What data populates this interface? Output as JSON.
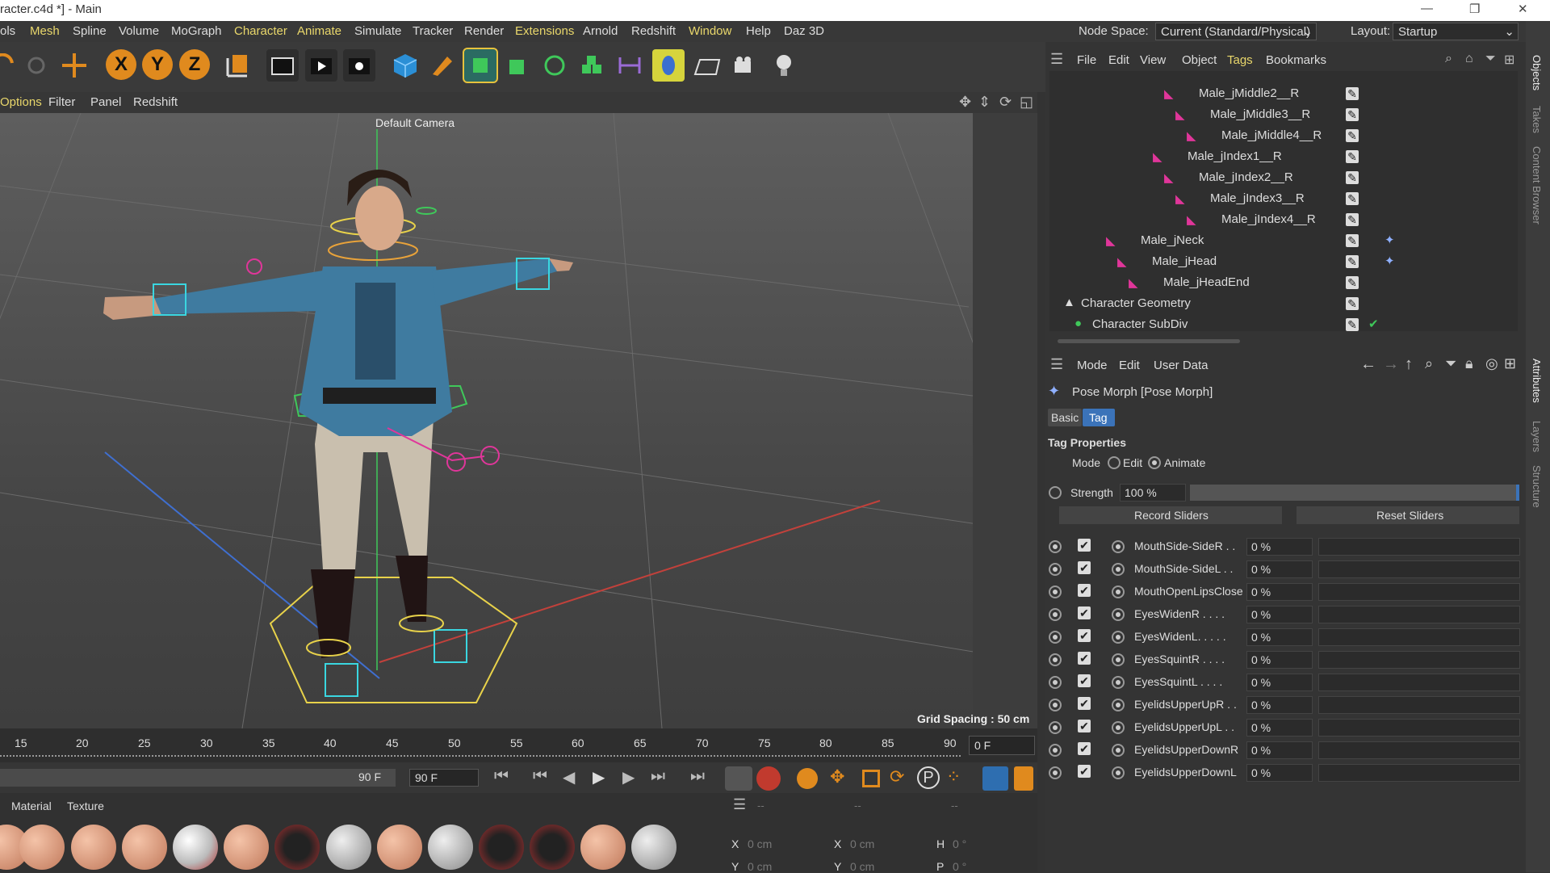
{
  "window": {
    "title": "racter.c4d *] - Main"
  },
  "menu": [
    "ols",
    "Mesh",
    "Spline",
    "Volume",
    "MoGraph",
    "Character",
    "Animate",
    "Simulate",
    "Tracker",
    "Render",
    "Extensions",
    "Arnold",
    "Redshift",
    "Window",
    "Help",
    "Daz 3D"
  ],
  "header": {
    "node_space_label": "Node Space:",
    "node_space_value": "Current (Standard/Physical)",
    "layout_label": "Layout:",
    "layout_value": "Startup"
  },
  "viewport": {
    "menu": [
      "Options",
      "Filter",
      "Panel",
      "Redshift"
    ],
    "camera": "Default Camera",
    "grid_spacing": "Grid Spacing : 50 cm"
  },
  "object_manager": {
    "menu": [
      "File",
      "Edit",
      "View",
      "Object",
      "Tags",
      "Bookmarks"
    ],
    "items": [
      "Male_jMiddle2__R",
      "Male_jMiddle3__R",
      "Male_jMiddle4__R",
      "Male_jIndex1__R",
      "Male_jIndex2__R",
      "Male_jIndex3__R",
      "Male_jIndex4__R",
      "Male_jNeck",
      "Male_jHead",
      "Male_jHeadEnd",
      "Character Geometry",
      "Character SubDiv"
    ]
  },
  "attributes": {
    "menu": [
      "Mode",
      "Edit",
      "User Data"
    ],
    "object_title": "Pose Morph [Pose Morph]",
    "tabs": [
      "Basic",
      "Tag"
    ],
    "section": "Tag Properties",
    "mode_label": "Mode",
    "mode_edit": "Edit",
    "mode_animate": "Animate",
    "strength_label": "Strength",
    "strength_value": "100 %",
    "record_button": "Record Sliders",
    "reset_button": "Reset Sliders",
    "morphs": [
      {
        "name": "MouthSide-SideR . .",
        "value": "0 %"
      },
      {
        "name": "MouthSide-SideL . .",
        "value": "0 %"
      },
      {
        "name": "MouthOpenLipsClose",
        "value": "0 %"
      },
      {
        "name": "EyesWidenR . . . .",
        "value": "0 %"
      },
      {
        "name": "EyesWidenL. . . . .",
        "value": "0 %"
      },
      {
        "name": "EyesSquintR . . . .",
        "value": "0 %"
      },
      {
        "name": "EyesSquintL . . . .",
        "value": "0 %"
      },
      {
        "name": "EyelidsUpperUpR . .",
        "value": "0 %"
      },
      {
        "name": "EyelidsUpperUpL . .",
        "value": "0 %"
      },
      {
        "name": "EyelidsUpperDownR",
        "value": "0 %"
      },
      {
        "name": "EyelidsUpperDownL",
        "value": "0 %"
      }
    ]
  },
  "right_tabs": [
    "Objects",
    "Takes",
    "Content Browser",
    "Attributes",
    "Layers",
    "Structure"
  ],
  "timeline": {
    "ticks": [
      "15",
      "20",
      "25",
      "30",
      "35",
      "40",
      "45",
      "50",
      "55",
      "60",
      "65",
      "70",
      "75",
      "80",
      "85",
      "90"
    ],
    "current_frame": "0 F",
    "end_frame_a": "90 F",
    "end_frame_b": "90 F"
  },
  "materials": {
    "menu": [
      "Material",
      "Texture"
    ]
  },
  "coords": {
    "x_label": "X",
    "y_label": "Y",
    "h_label": "H",
    "p_label": "P",
    "x_val": "0 cm",
    "y_val": "0 cm",
    "x2_val": "0 cm",
    "y2_val": "0 cm",
    "h_val": "0 °",
    "p_val": "0 °",
    "dash1": "--",
    "dash2": "--",
    "dash3": "--"
  }
}
